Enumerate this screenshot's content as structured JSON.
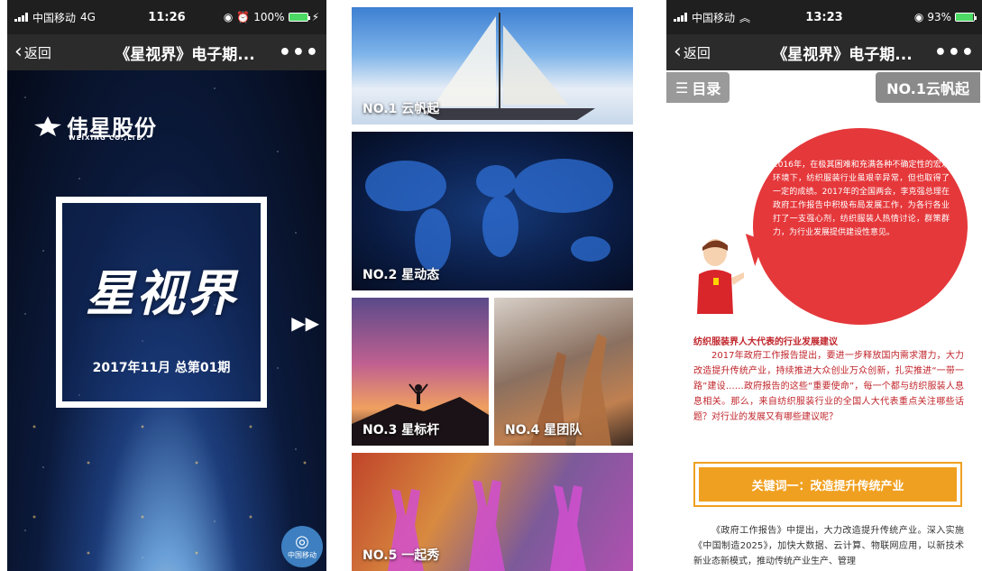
{
  "phone1": {
    "status": {
      "carrier": "中国移动",
      "network": "4G",
      "time": "11:26",
      "battery": "100%",
      "battery_level": 1.0
    },
    "nav": {
      "back_label": "返回",
      "title": "《星视界》电子期...",
      "more": "•••"
    },
    "cover": {
      "brand": "伟星股份",
      "brand_sub": "WEIXING CO.,LTD.",
      "magazine_title": "星视界",
      "issue": "2017年11月  总第01期",
      "play_icon": "double-chevron-right-icon",
      "carrier_badge": "中国移动"
    }
  },
  "phone2": {
    "tiles": [
      {
        "label": "NO.1 云帆起"
      },
      {
        "label": "NO.2 星动态"
      },
      {
        "label": "NO.3 星标杆"
      },
      {
        "label": "NO.4 星团队"
      },
      {
        "label": "NO.5 一起秀"
      }
    ]
  },
  "phone3": {
    "status": {
      "carrier": "中国移动",
      "network": "wifi",
      "time": "13:23",
      "battery": "93%",
      "battery_level": 0.93
    },
    "nav": {
      "back_label": "返回",
      "title": "《星视界》电子期...",
      "more": "•••"
    },
    "menu_button": "目录",
    "section_badge": "NO.1云帆起",
    "bubble_text": "2016年，在极其困难和充满各种不确定性的宏观环境下，纺织服装行业虽艰辛异常，但也取得了一定的成绩。2017年的全国两会，李克强总理在政府工作报告中积极布局发展工作，为各行各业打了一支强心剂，纺织服装人热情讨论，群策群力，为行业发展提供建设性意见。",
    "section_title": "纺织服装界人大代表的行业发展建议",
    "section_body": "2017年政府工作报告提出，要进一步释放国内需求潜力，大力改造提升传统产业，持续推进大众创业万众创新，扎实推进“一带一路”建设……政府报告的这些“重要使命”，每一个都与纺织服装人息息相关。那么，来自纺织服装行业的全国人大代表重点关注哪些话题？对行业的发展又有哪些建议呢？",
    "keyword": "关键词一：改造提升传统产业",
    "body2": "《政府工作报告》中提出，大力改造提升传统产业。深入实施《中国制造2025》，加快大数据、云计算、物联网应用，以新技术新业态新模式，推动传统产业生产、管理"
  }
}
